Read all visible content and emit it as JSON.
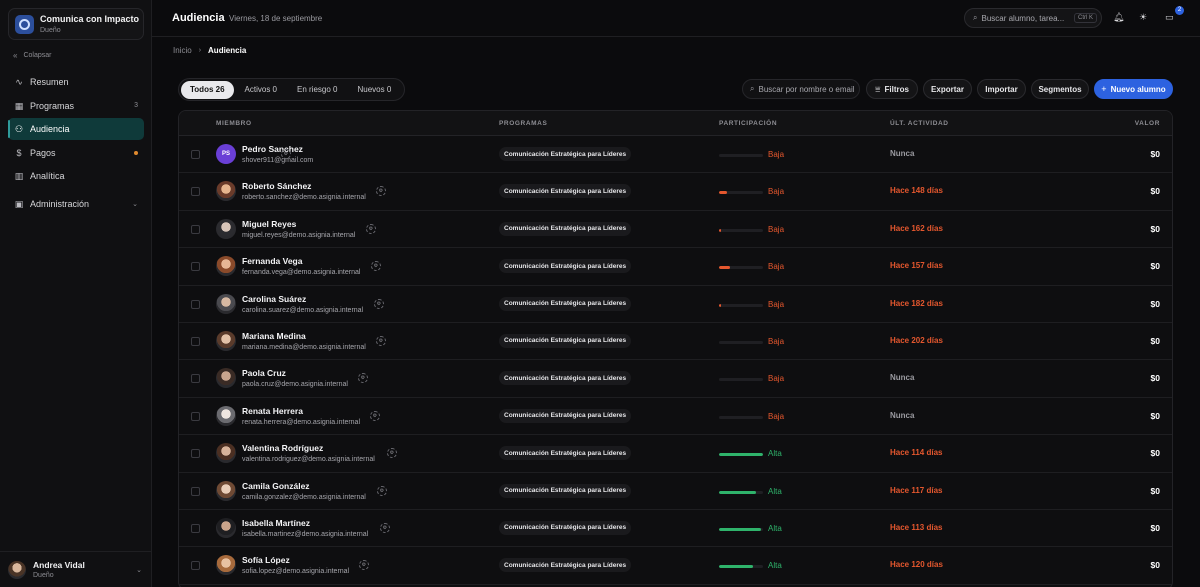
{
  "sidebar": {
    "brand_title": "Comunica con Impacto",
    "brand_sub": "Dueño",
    "collapse_label": "Colapsar",
    "items": [
      {
        "label": "Resumen",
        "icon": "activity-icon",
        "count": "",
        "dot": false,
        "chevron": false,
        "active": false
      },
      {
        "label": "Programas",
        "icon": "grid-icon",
        "count": "3",
        "dot": false,
        "chevron": false,
        "active": false
      },
      {
        "label": "Audiencia",
        "icon": "users-icon",
        "count": "",
        "dot": false,
        "chevron": false,
        "active": true
      },
      {
        "label": "Pagos",
        "icon": "dollar-icon",
        "count": "",
        "dot": true,
        "chevron": false,
        "active": false
      },
      {
        "label": "Analítica",
        "icon": "chart-icon",
        "count": "",
        "dot": false,
        "chevron": false,
        "active": false
      },
      {
        "label": "Administración",
        "icon": "panel-icon",
        "count": "",
        "dot": false,
        "chevron": true,
        "active": false
      }
    ],
    "user_name": "Andrea Vidal",
    "user_role": "Dueño"
  },
  "header": {
    "title": "Audiencia",
    "date": "Viernes, 18 de septiembre",
    "search_placeholder": "Buscar alumno, tarea...",
    "search_shortcut": "Ctrl K",
    "notifications_badge": "2"
  },
  "breadcrumb": {
    "home": "Inicio",
    "current": "Audiencia"
  },
  "filters": {
    "tabs": [
      {
        "label": "Todos 26",
        "active": true
      },
      {
        "label": "Activos 0",
        "active": false
      },
      {
        "label": "En riesgo 0",
        "active": false
      },
      {
        "label": "Nuevos 0",
        "active": false
      }
    ],
    "search_placeholder": "Buscar por nombre o email",
    "filters_label": "Filtros",
    "export_label": "Exportar",
    "import_label": "Importar",
    "segments_label": "Segmentos",
    "new_label": "Nuevo alumno"
  },
  "table": {
    "columns": [
      "MIEMBRO",
      "PROGRAMAS",
      "PARTICIPACIÓN",
      "ÚLT. ACTIVIDAD",
      "VALOR"
    ],
    "colors": {
      "low": "#e4572e",
      "high": "#2fb36b",
      "muted": "#9a9aa0",
      "accent": "#2d62e0"
    },
    "rows": [
      {
        "name": "Pedro Sanchez",
        "email": "shover911@gmail.com",
        "initials": "PS",
        "program": "Comunicación Estratégica para Líderes",
        "participation": 0.0,
        "level": "Baja",
        "activity": "Nunca",
        "value": "$0"
      },
      {
        "name": "Roberto Sánchez",
        "email": "roberto.sanchez@demo.asignia.internal",
        "initials": "",
        "program": "Comunicación Estratégica para Líderes",
        "participation": 0.18,
        "level": "Baja",
        "activity": "Hace 148 días",
        "value": "$0"
      },
      {
        "name": "Miguel Reyes",
        "email": "miguel.reyes@demo.asignia.internal",
        "initials": "",
        "program": "Comunicación Estratégica para Líderes",
        "participation": 0.05,
        "level": "Baja",
        "activity": "Hace 162 días",
        "value": "$0"
      },
      {
        "name": "Fernanda Vega",
        "email": "fernanda.vega@demo.asignia.internal",
        "initials": "",
        "program": "Comunicación Estratégica para Líderes",
        "participation": 0.26,
        "level": "Baja",
        "activity": "Hace 157 días",
        "value": "$0"
      },
      {
        "name": "Carolina Suárez",
        "email": "carolina.suarez@demo.asignia.internal",
        "initials": "",
        "program": "Comunicación Estratégica para Líderes",
        "participation": 0.05,
        "level": "Baja",
        "activity": "Hace 182 días",
        "value": "$0"
      },
      {
        "name": "Mariana Medina",
        "email": "mariana.medina@demo.asignia.internal",
        "initials": "",
        "program": "Comunicación Estratégica para Líderes",
        "participation": 0.0,
        "level": "Baja",
        "activity": "Hace 202 días",
        "value": "$0"
      },
      {
        "name": "Paola Cruz",
        "email": "paola.cruz@demo.asignia.internal",
        "initials": "",
        "program": "Comunicación Estratégica para Líderes",
        "participation": 0.0,
        "level": "Baja",
        "activity": "Nunca",
        "value": "$0"
      },
      {
        "name": "Renata Herrera",
        "email": "renata.herrera@demo.asignia.internal",
        "initials": "",
        "program": "Comunicación Estratégica para Líderes",
        "participation": 0.0,
        "level": "Baja",
        "activity": "Nunca",
        "value": "$0"
      },
      {
        "name": "Valentina Rodríguez",
        "email": "valentina.rodriguez@demo.asignia.internal",
        "initials": "",
        "program": "Comunicación Estratégica para Líderes",
        "participation": 1.0,
        "level": "Alta",
        "activity": "Hace 114 días",
        "value": "$0"
      },
      {
        "name": "Camila González",
        "email": "camila.gonzalez@demo.asignia.internal",
        "initials": "",
        "program": "Comunicación Estratégica para Líderes",
        "participation": 0.84,
        "level": "Alta",
        "activity": "Hace 117 días",
        "value": "$0"
      },
      {
        "name": "Isabella Martínez",
        "email": "isabella.martinez@demo.asignia.internal",
        "initials": "",
        "program": "Comunicación Estratégica para Líderes",
        "participation": 0.95,
        "level": "Alta",
        "activity": "Hace 113 días",
        "value": "$0"
      },
      {
        "name": "Sofía López",
        "email": "sofia.lopez@demo.asignia.internal",
        "initials": "",
        "program": "Comunicación Estratégica para Líderes",
        "participation": 0.77,
        "level": "Alta",
        "activity": "Hace 120 días",
        "value": "$0"
      }
    ]
  }
}
